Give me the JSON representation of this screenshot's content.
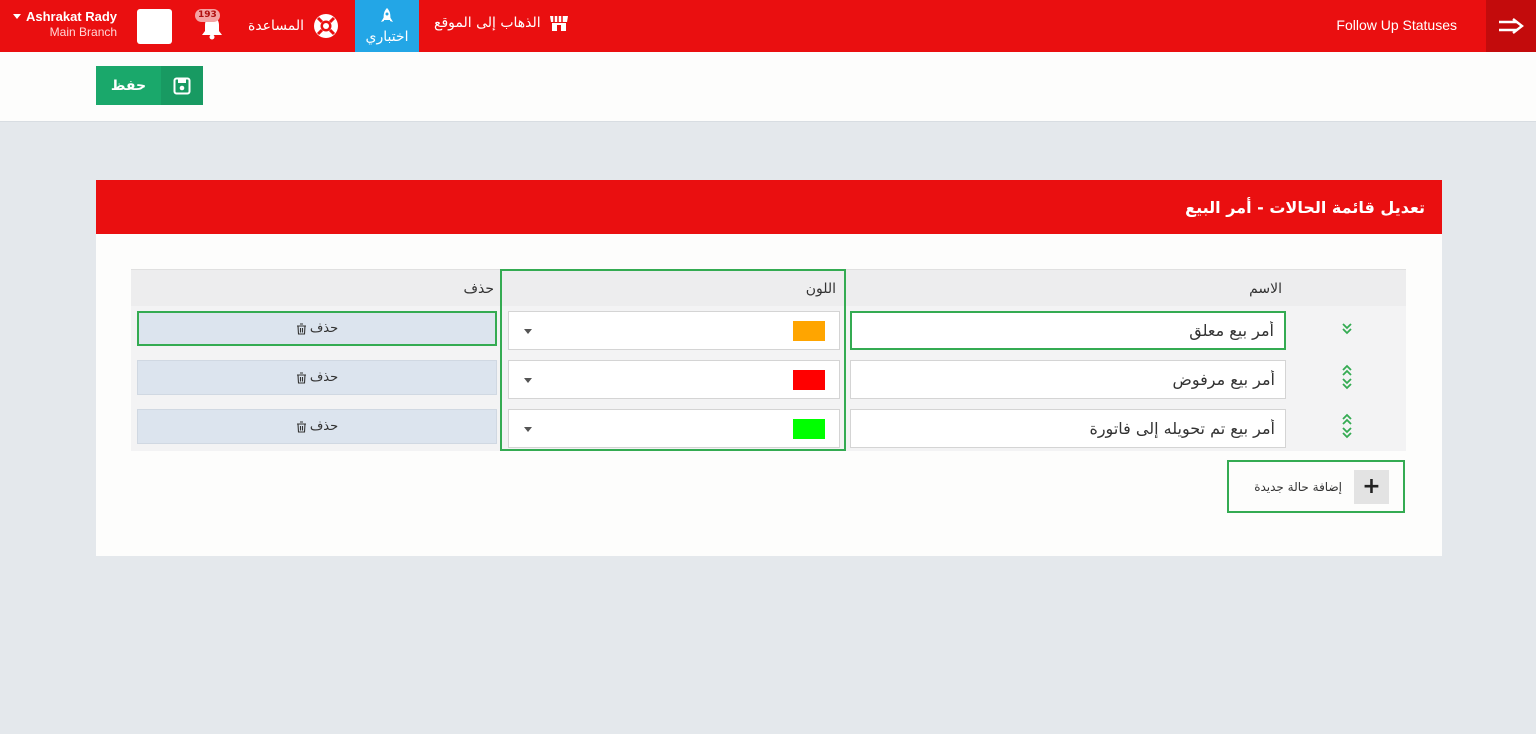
{
  "topbar": {
    "page_title": "Follow Up Statuses",
    "user_name": "Ashrakat Rady",
    "user_branch": "Main Branch",
    "notifications_count": "193",
    "help_label": "المساعدة",
    "test_label": "اختباري",
    "goto_site_label": "الذهاب إلى الموقع",
    "bar_color": "#ea0f10",
    "test_color": "#23a6e6"
  },
  "toolbar": {
    "save_label": "حفظ",
    "save_color": "#1aa86b"
  },
  "panel": {
    "title": "تعديل قائمة الحالات - أمر البيع",
    "columns": {
      "name": "الاسم",
      "color": "اللون",
      "delete": "حذف"
    },
    "rows": [
      {
        "name": "أمر بيع معلق",
        "color": "#ffa500",
        "delete_label": "حذف",
        "move_up": false,
        "move_down": true
      },
      {
        "name": "أمر بيع مرفوض",
        "color": "#ff0000",
        "delete_label": "حذف",
        "move_up": true,
        "move_down": true
      },
      {
        "name": "أمر بيع تم تحويله إلى فاتورة",
        "color": "#00ff00",
        "delete_label": "حذف",
        "move_up": true,
        "move_down": true
      }
    ],
    "add_label": "إضافة حالة جديدة"
  }
}
